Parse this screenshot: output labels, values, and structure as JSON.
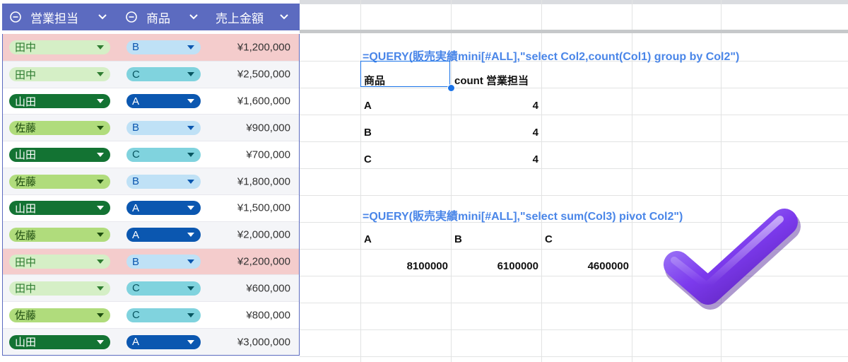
{
  "table": {
    "headers": [
      "営業担当",
      "商品",
      "売上金額"
    ],
    "rows": [
      {
        "rep": "田中",
        "product": "B",
        "amount": "¥1,200,000"
      },
      {
        "rep": "田中",
        "product": "C",
        "amount": "¥2,500,000"
      },
      {
        "rep": "山田",
        "product": "A",
        "amount": "¥1,600,000"
      },
      {
        "rep": "佐藤",
        "product": "B",
        "amount": "¥900,000"
      },
      {
        "rep": "山田",
        "product": "C",
        "amount": "¥700,000"
      },
      {
        "rep": "佐藤",
        "product": "B",
        "amount": "¥1,800,000"
      },
      {
        "rep": "山田",
        "product": "A",
        "amount": "¥1,500,000"
      },
      {
        "rep": "佐藤",
        "product": "A",
        "amount": "¥2,000,000"
      },
      {
        "rep": "田中",
        "product": "B",
        "amount": "¥2,200,000"
      },
      {
        "rep": "田中",
        "product": "C",
        "amount": "¥600,000"
      },
      {
        "rep": "佐藤",
        "product": "C",
        "amount": "¥800,000"
      },
      {
        "rep": "山田",
        "product": "A",
        "amount": "¥3,000,000"
      }
    ],
    "highlighted_rows": [
      0,
      8
    ]
  },
  "chip_colors": {
    "田中": {
      "bg": "#d5efc6",
      "fg": "#2f7d32"
    },
    "山田": {
      "bg": "#137333",
      "fg": "#ffffff"
    },
    "佐藤": {
      "bg": "#b0dc7c",
      "fg": "#1e4d10"
    },
    "A": {
      "bg": "#0b57b0",
      "fg": "#ffffff"
    },
    "B": {
      "bg": "#bfe1f6",
      "fg": "#0b57b0"
    },
    "C": {
      "bg": "#80d3de",
      "fg": "#075560"
    }
  },
  "query1": {
    "formula": "=QUERY(販売実績mini[#ALL],\"select Col2,count(Col1) group by Col2\")",
    "header_product": "商品",
    "header_count": "count 営業担当",
    "rows": [
      {
        "product": "A",
        "count": "4"
      },
      {
        "product": "B",
        "count": "4"
      },
      {
        "product": "C",
        "count": "4"
      }
    ]
  },
  "query2": {
    "formula": "=QUERY(販売実績mini[#ALL],\"select sum(Col3) pivot Col2\")",
    "headers": [
      "A",
      "B",
      "C"
    ],
    "values": [
      "8100000",
      "6100000",
      "4600000"
    ]
  },
  "icons": {
    "filter": "filter-circle-icon",
    "dropdown": "chevron-down-icon",
    "check": "checkmark-icon"
  }
}
